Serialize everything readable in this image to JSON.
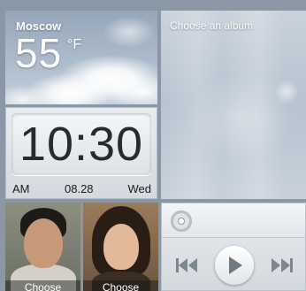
{
  "weather": {
    "city": "Moscow",
    "temperature": "55",
    "unit": "°F",
    "icon": "cloudy-weather-icon"
  },
  "clock": {
    "time": "10:30",
    "ampm": "AM",
    "date": "08.28",
    "day": "Wed"
  },
  "album": {
    "label": "Choose an album"
  },
  "contacts": [
    {
      "label": "Choose"
    },
    {
      "label": "Choose"
    }
  ],
  "music": {
    "disc_icon": "disc-icon",
    "prev_icon": "previous-track-icon",
    "play_icon": "play-icon",
    "next_icon": "next-track-icon"
  }
}
